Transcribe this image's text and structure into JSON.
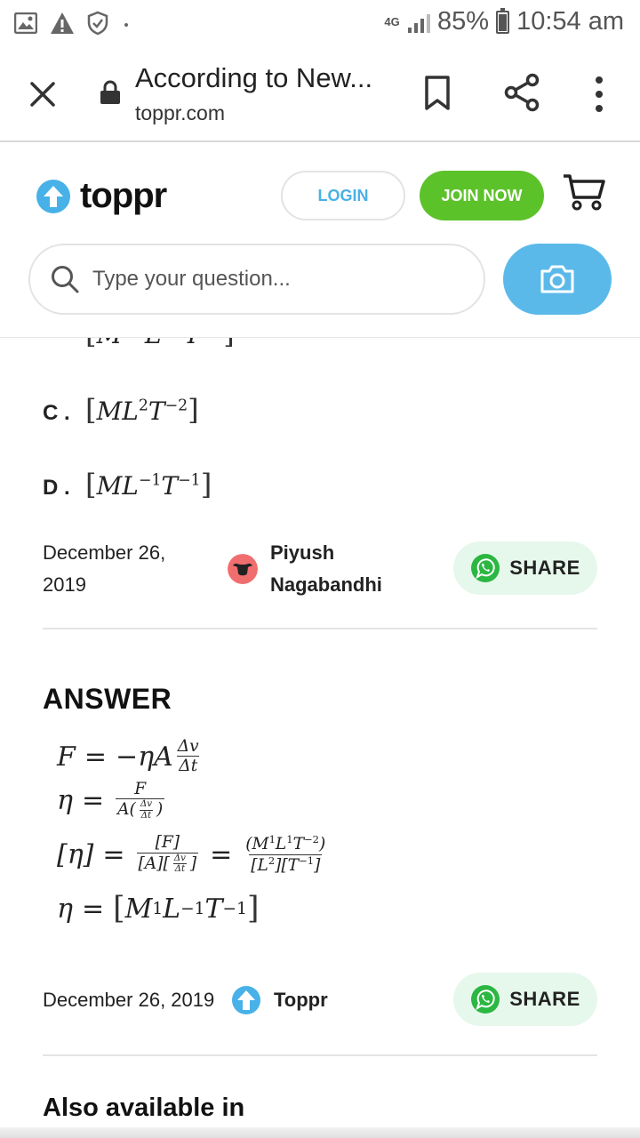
{
  "status_bar": {
    "network": "4G",
    "battery": "85%",
    "battery_level": 0.85,
    "time": "10:54 am"
  },
  "browser": {
    "page_title": "According to New...",
    "url": "toppr.com"
  },
  "header": {
    "logo_text": "toppr",
    "login_label": "LOGIN",
    "join_label": "JOIN NOW",
    "search_placeholder": "Type your question...",
    "accent_color": "#5bb9ea",
    "join_color": "#5cc22a"
  },
  "question": {
    "options": [
      {
        "letter": "C",
        "M": "M",
        "L": "L",
        "L_exp": "2",
        "T": "T",
        "T_exp": "−2"
      },
      {
        "letter": "D",
        "M": "M",
        "L": "L",
        "L_exp": "−1",
        "T": "T",
        "T_exp": "−1"
      }
    ],
    "meta": {
      "date": "December 26, 2019",
      "author": "Piyush Nagabandhi",
      "share_label": "SHARE"
    }
  },
  "answer": {
    "heading": "ANSWER",
    "meta": {
      "date": "December 26, 2019",
      "author": "Toppr",
      "share_label": "SHARE"
    }
  },
  "footer": {
    "also_available": "Also available in"
  }
}
